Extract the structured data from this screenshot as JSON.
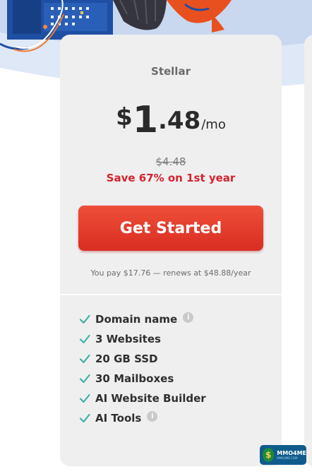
{
  "plan": {
    "name": "Stellar",
    "currency": "$",
    "price_whole": "1",
    "price_cents": ".48",
    "period": "/mo",
    "original_price": "$4.48",
    "savings": "Save 67% on 1st year",
    "cta_label": "Get Started",
    "renewal_note": "You pay $17.76 — renews at $48.88/year"
  },
  "features": [
    {
      "label": "Domain name",
      "info": true
    },
    {
      "label": "3 Websites",
      "info": false
    },
    {
      "label": "20 GB SSD",
      "info": false
    },
    {
      "label": "30 Mailboxes",
      "info": false
    },
    {
      "label": "AI Website Builder",
      "info": false
    },
    {
      "label": "AI Tools",
      "info": true
    }
  ],
  "info_icon_glyph": "i",
  "watermark": {
    "text": "MMO4ME",
    "subtext": "MMO4ME.COM",
    "coin": "$"
  },
  "colors": {
    "accent": "#d92d22",
    "check": "#3fb0a6",
    "card": "#efeff0",
    "hero_blue": "#1e4fa3"
  }
}
